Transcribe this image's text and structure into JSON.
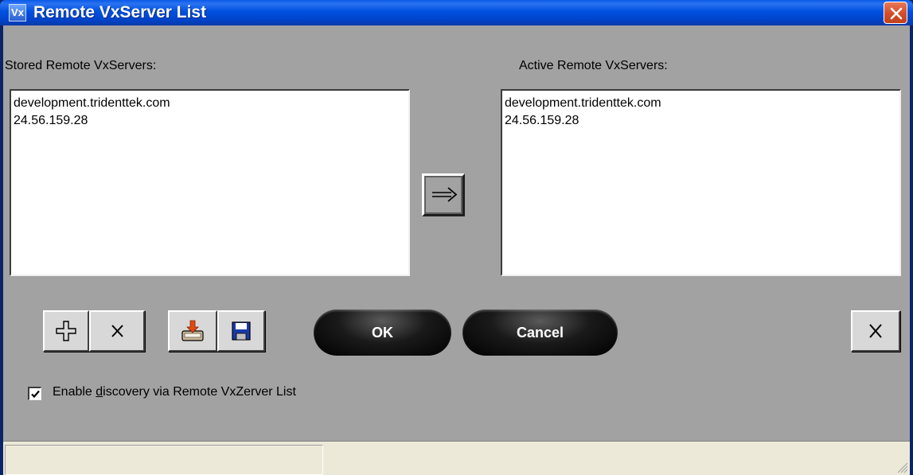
{
  "window": {
    "title": "Remote VxServer List",
    "app_icon": "Vx",
    "close_icon": "close-icon"
  },
  "stored": {
    "label": "Stored Remote VxServers:",
    "items": [
      "development.tridenttek.com",
      "24.56.159.28"
    ]
  },
  "active": {
    "label": "Active Remote VxServers:",
    "items": [
      "development.tridenttek.com",
      "24.56.159.28"
    ]
  },
  "transfer_button": {
    "icon": "right-arrow-icon"
  },
  "toolbar": {
    "add_icon": "plus-icon",
    "remove_icon": "x-icon",
    "load_icon": "import-icon",
    "save_icon": "floppy-disk-icon"
  },
  "buttons": {
    "ok": "OK",
    "cancel": "Cancel",
    "close_icon": "x-icon"
  },
  "discovery": {
    "checked": true,
    "label_prefix": "Enable ",
    "label_underlined": "d",
    "label_suffix": "iscovery via Remote VxZerver List"
  },
  "statusbar": {
    "text": ""
  },
  "colors": {
    "titlebar": "#0050e0",
    "client": "#a2a2a2",
    "close": "#d5502c",
    "pill": "#000000"
  }
}
